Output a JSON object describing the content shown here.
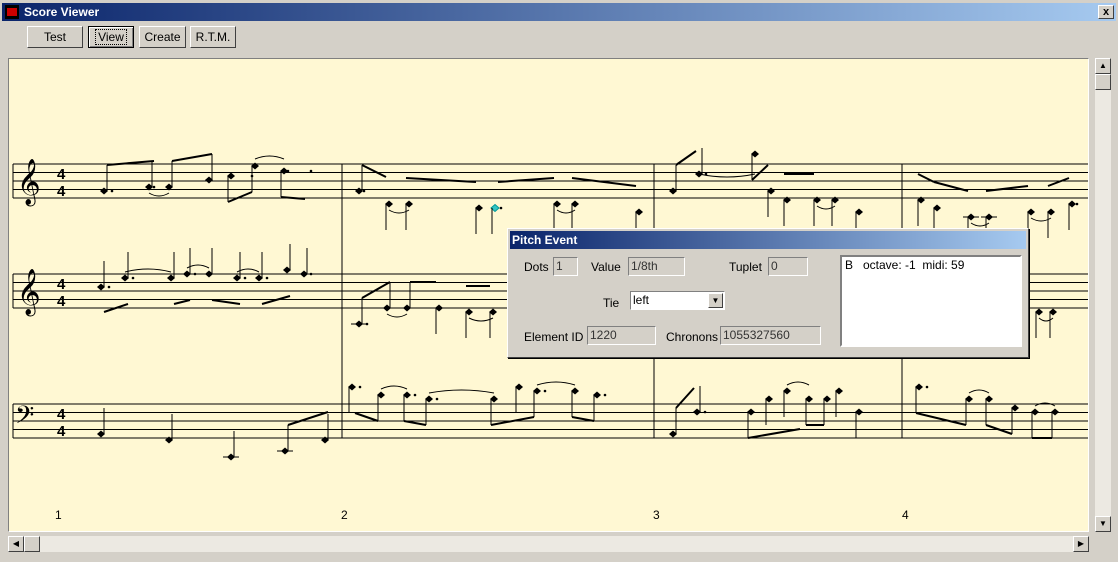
{
  "window": {
    "title": "Score Viewer",
    "close_glyph": "x"
  },
  "toolbar": {
    "test_label": "Test",
    "view_label": "View",
    "create_label": "Create",
    "rtm_label": "R.T.M."
  },
  "score": {
    "staves": [
      {
        "clef": "treble",
        "time": [
          "4",
          "4"
        ]
      },
      {
        "clef": "treble",
        "time": [
          "4",
          "4"
        ]
      },
      {
        "clef": "bass",
        "time": [
          "4",
          "4"
        ]
      }
    ],
    "measure_numbers": [
      "1",
      "2",
      "3",
      "4"
    ],
    "selected_note_color": "#33c3c3"
  },
  "pitch_event": {
    "title": "Pitch Event",
    "dots_label": "Dots",
    "dots_value": "1",
    "value_label": "Value",
    "value_value": "1/8th",
    "tuplet_label": "Tuplet",
    "tuplet_value": "0",
    "tie_label": "Tie",
    "tie_value": "left",
    "element_id_label": "Element ID",
    "element_id_value": "1220",
    "chronons_label": "Chronons",
    "chronons_value": "1055327560",
    "list_items": [
      {
        "note": "B",
        "octave": "octave: -1",
        "midi": "midi: 59"
      }
    ]
  },
  "colors": {
    "titlebar_start": "#0a246a",
    "titlebar_end": "#a6caf0",
    "paper": "#fff8d3"
  }
}
